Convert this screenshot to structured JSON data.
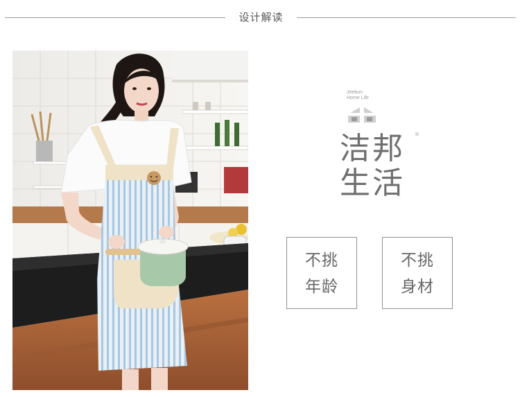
{
  "header": {
    "title": "设计解读"
  },
  "photo": {
    "subject": "apron-model-photo"
  },
  "brand": {
    "english": [
      "Jeebon",
      "Home Life"
    ],
    "name_line1": "洁邦",
    "name_line2": "生活",
    "registered": "®"
  },
  "features": [
    {
      "line1": "不挑",
      "line2": "年龄"
    },
    {
      "line1": "不挑",
      "line2": "身材"
    }
  ],
  "colors": {
    "apron_stripe": "#a9c6de",
    "apron_pocket": "#efe2c6",
    "pot": "#a7c9a9",
    "counter": "#1d1d1d",
    "cabinet": "#a8623a"
  }
}
